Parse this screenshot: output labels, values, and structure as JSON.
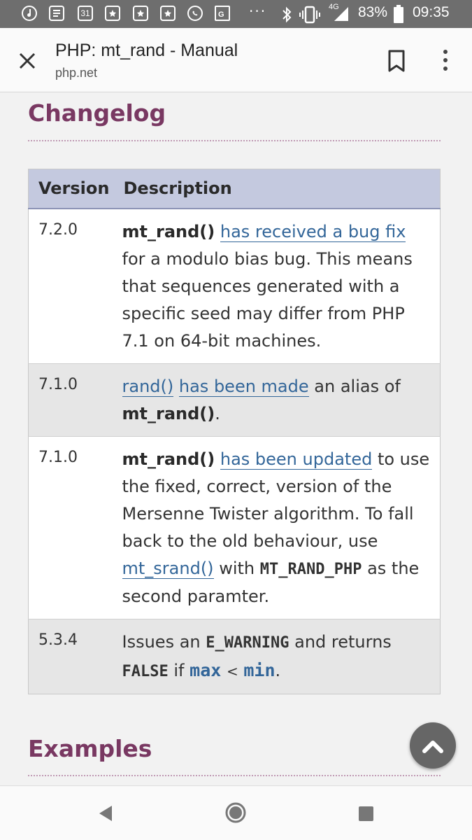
{
  "status_bar": {
    "icons": [
      "music-icon",
      "news-icon",
      "calendar-icon",
      "bookmark-icon",
      "bookmark-icon",
      "bookmark-icon",
      "whatsapp-icon",
      "maps-icon"
    ],
    "calendar_day": "31",
    "overflow": "···",
    "network": "4G",
    "battery": "83%",
    "time": "09:35"
  },
  "app_bar": {
    "title": "PHP: mt_rand - Manual",
    "subtitle": "php.net"
  },
  "changelog": {
    "heading": "Changelog",
    "columns": [
      "Version",
      "Description"
    ],
    "rows": [
      {
        "version": "7.2.0",
        "fn": "mt_rand()",
        "link": "has received a bug fix",
        "text": "for a modulo bias bug. This means that sequences generated with a specific seed may differ from PHP 7.1 on 64-bit machines."
      },
      {
        "version": "7.1.0",
        "link1": "rand()",
        "link2": "has been made",
        "text1": "an alias of",
        "fn": "mt_rand()",
        "text2": "."
      },
      {
        "version": "7.1.0",
        "fn": "mt_rand()",
        "link": "has been updated",
        "text1": "to use the fixed, correct, version of the Mersenne Twister algorithm. To fall back to the old behaviour, use",
        "link2": "mt_srand()",
        "text2": "with",
        "code": "MT_RAND_PHP",
        "text3": "as the second paramter."
      },
      {
        "version": "5.3.4",
        "text1": "Issues an",
        "code1": "E_WARNING",
        "text2": "and returns",
        "code2": "FALSE",
        "text3": "if",
        "param1": "max",
        "op": "<",
        "param2": "min",
        "text4": "."
      }
    ]
  },
  "examples": {
    "heading": "Examples"
  },
  "colors": {
    "heading": "#793862",
    "link": "#336699",
    "table_header": "#c4c9df"
  }
}
